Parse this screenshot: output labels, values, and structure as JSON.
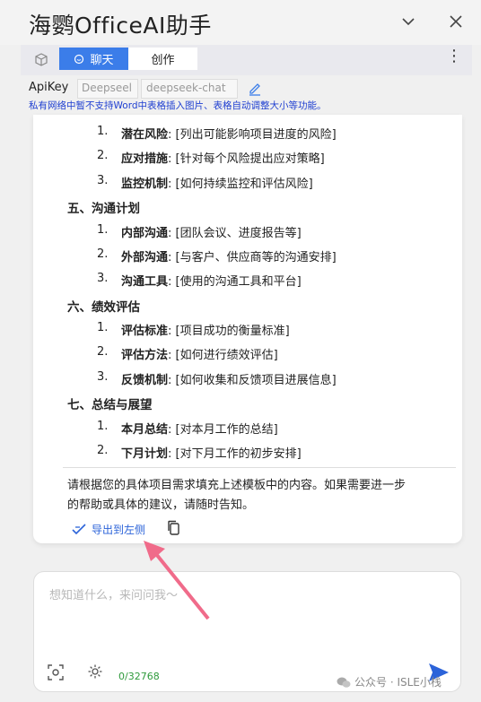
{
  "pane": {
    "title": "海鹦OfficeAI助手",
    "collapse_icon": "chevron-down-icon",
    "close_icon": "close-icon"
  },
  "toolbar": {
    "tab_chat": "聊天",
    "tab_create": "创作",
    "more_icon": "more-vertical-icon"
  },
  "apikey": {
    "label": "ApiKey",
    "value": "Deepseel",
    "model": "deepseek-chat"
  },
  "warning": "私有网络中暂不支持Word中表格插入图片、表格自动调整大小等功能。",
  "content": {
    "risk_items": [
      {
        "num": "1.",
        "bold": "潜在风险",
        "rest": ": [列出可能影响项目进度的风险]"
      },
      {
        "num": "2.",
        "bold": "应对措施",
        "rest": ": [针对每个风险提出应对策略]"
      },
      {
        "num": "3.",
        "bold": "监控机制",
        "rest": ": [如何持续监控和评估风险]"
      }
    ],
    "sec5": "五、沟通计划",
    "comm_items": [
      {
        "num": "1.",
        "bold": "内部沟通",
        "rest": ": [团队会议、进度报告等]"
      },
      {
        "num": "2.",
        "bold": "外部沟通",
        "rest": ": [与客户、供应商等的沟通安排]"
      },
      {
        "num": "3.",
        "bold": "沟通工具",
        "rest": ": [使用的沟通工具和平台]"
      }
    ],
    "sec6": "六、绩效评估",
    "eval_items": [
      {
        "num": "1.",
        "bold": "评估标准",
        "rest": ": [项目成功的衡量标准]"
      },
      {
        "num": "2.",
        "bold": "评估方法",
        "rest": ": [如何进行绩效评估]"
      },
      {
        "num": "3.",
        "bold": "反馈机制",
        "rest": ": [如何收集和反馈项目进展信息]"
      }
    ],
    "sec7": "七、总结与展望",
    "summary_items": [
      {
        "num": "1.",
        "bold": "本月总结",
        "rest": ": [对本月工作的总结]"
      },
      {
        "num": "2.",
        "bold": "下月计划",
        "rest": ": [对下月工作的初步安排]"
      }
    ],
    "closing_line1": "请根据您的具体项目需求填充上述模板中的内容。如果需要进一步",
    "closing_line2": "的帮助或具体的建议，请随时告知。"
  },
  "actions": {
    "export_label": "导出到左侧",
    "copy_icon": "copy-icon"
  },
  "input": {
    "placeholder": "想知道什么，来问问我～",
    "counter": "0/32768",
    "send_icon": "send-icon"
  },
  "watermark": "公众号 · ISLE小栈",
  "colors": {
    "accent": "#3b7de9",
    "warning": "#1f3fd1",
    "counter": "#2f9a3c",
    "annotation_arrow": "#f06b8a"
  }
}
